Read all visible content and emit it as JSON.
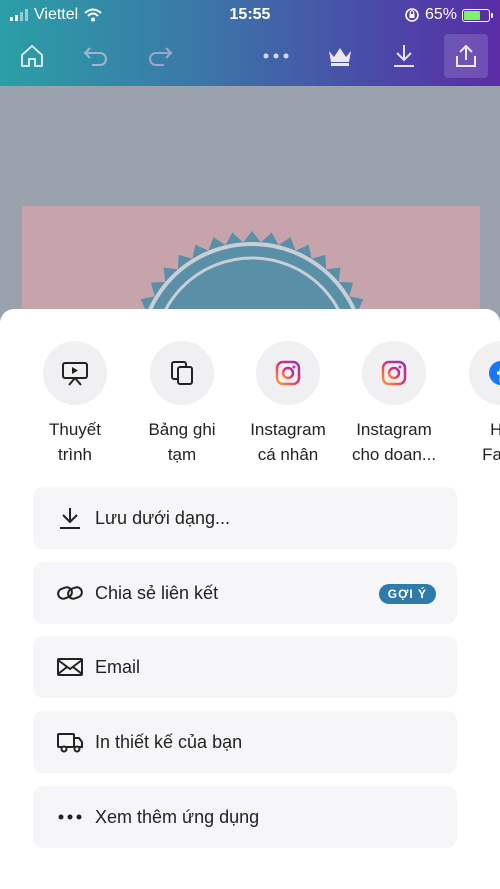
{
  "status_bar": {
    "carrier": "Viettel",
    "time": "15:55",
    "battery": "65%",
    "battery_level": 0.65
  },
  "toolbar": {
    "home_icon": "home-icon",
    "undo_icon": "undo-icon",
    "redo_icon": "redo-icon",
    "more_icon": "more-icon",
    "crown_icon": "crown-icon",
    "download_icon": "download-icon",
    "share_icon": "share-icon"
  },
  "share_targets": [
    {
      "line1": "Thuyết",
      "line2": "trình",
      "icon": "present-icon"
    },
    {
      "line1": "Bảng ghi",
      "line2": "tạm",
      "icon": "clipboard-icon"
    },
    {
      "line1": "Instagram",
      "line2": "cá nhân",
      "icon": "instagram-icon"
    },
    {
      "line1": "Instagram",
      "line2": "cho doan...",
      "icon": "instagram-icon"
    },
    {
      "line1": "Hồ",
      "line2": "Face",
      "icon": "facebook-icon"
    }
  ],
  "menu": [
    {
      "label": "Lưu dưới dạng...",
      "icon": "download-icon"
    },
    {
      "label": "Chia sẻ liên kết",
      "icon": "link-icon",
      "tag": "GỢI Ý"
    },
    {
      "label": "Email",
      "icon": "mail-icon"
    },
    {
      "label": "In thiết kế của bạn",
      "icon": "truck-icon"
    },
    {
      "label": "Xem thêm ứng dụng",
      "icon": "more-icon"
    }
  ],
  "colors": {
    "tag_bg": "#2e7bab",
    "instagram": "#e1306c",
    "facebook": "#1877f2"
  }
}
